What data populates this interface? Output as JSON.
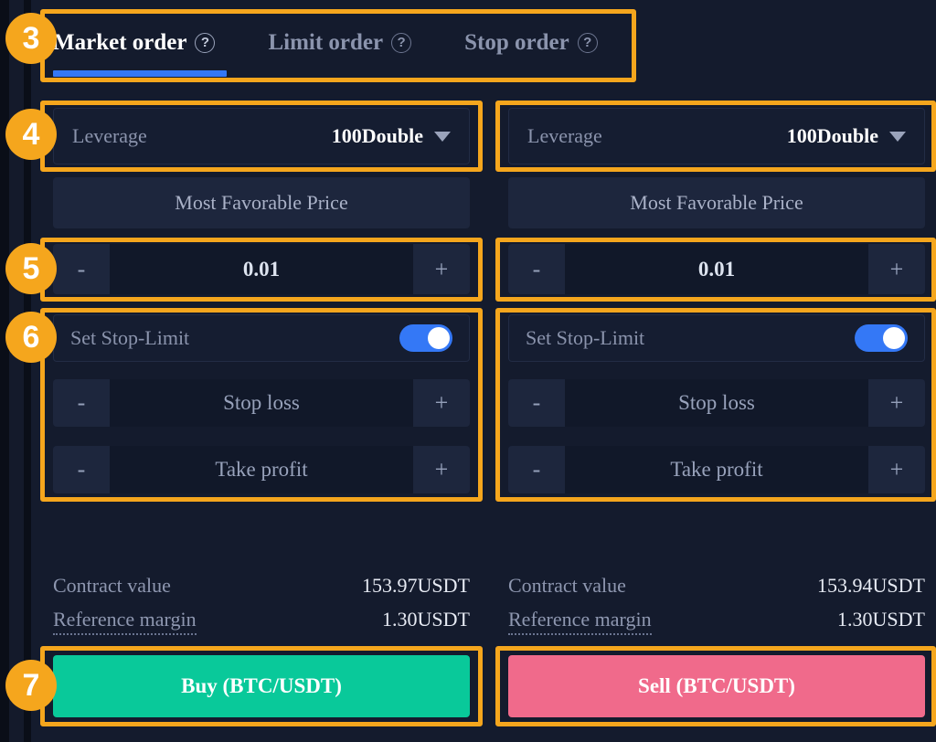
{
  "theme": {
    "bg": "#0d121f",
    "panel": "#141b2d",
    "field": "#151d31",
    "accent_blue": "#3478f6",
    "highlight_orange": "#f5a61d",
    "buy_green": "#09c99a",
    "sell_pink": "#f06a8b"
  },
  "tabs": [
    {
      "label": "Market order",
      "help_icon": "question-mark-icon",
      "active": true
    },
    {
      "label": "Limit order",
      "help_icon": "question-mark-icon",
      "active": false
    },
    {
      "label": "Stop order",
      "help_icon": "question-mark-icon",
      "active": false
    }
  ],
  "buy_column": {
    "leverage": {
      "label": "Leverage",
      "value": "100Double",
      "caret_icon": "chevron-down-icon"
    },
    "price_mode": {
      "label": "Most Favorable Price"
    },
    "quantity": {
      "minus": "-",
      "value": "0.01",
      "plus": "+"
    },
    "stop_limit": {
      "label": "Set Stop-Limit",
      "enabled": true
    },
    "stop_loss": {
      "minus": "-",
      "placeholder": "Stop loss",
      "plus": "+"
    },
    "take_profit": {
      "minus": "-",
      "placeholder": "Take profit",
      "plus": "+"
    },
    "summary": [
      {
        "key": "Contract value",
        "value": "153.97USDT",
        "dotted": false
      },
      {
        "key": "Reference margin",
        "value": "1.30USDT",
        "dotted": true
      }
    ],
    "action": {
      "label": "Buy (BTC/USDT)"
    }
  },
  "sell_column": {
    "leverage": {
      "label": "Leverage",
      "value": "100Double",
      "caret_icon": "chevron-down-icon"
    },
    "price_mode": {
      "label": "Most Favorable Price"
    },
    "quantity": {
      "minus": "-",
      "value": "0.01",
      "plus": "+"
    },
    "stop_limit": {
      "label": "Set Stop-Limit",
      "enabled": true
    },
    "stop_loss": {
      "minus": "-",
      "placeholder": "Stop loss",
      "plus": "+"
    },
    "take_profit": {
      "minus": "-",
      "placeholder": "Take profit",
      "plus": "+"
    },
    "summary": [
      {
        "key": "Contract value",
        "value": "153.94USDT",
        "dotted": false
      },
      {
        "key": "Reference margin",
        "value": "1.30USDT",
        "dotted": true
      }
    ],
    "action": {
      "label": "Sell (BTC/USDT)"
    }
  },
  "annotations": [
    {
      "number": "3"
    },
    {
      "number": "4"
    },
    {
      "number": "5"
    },
    {
      "number": "6"
    },
    {
      "number": "7"
    }
  ]
}
